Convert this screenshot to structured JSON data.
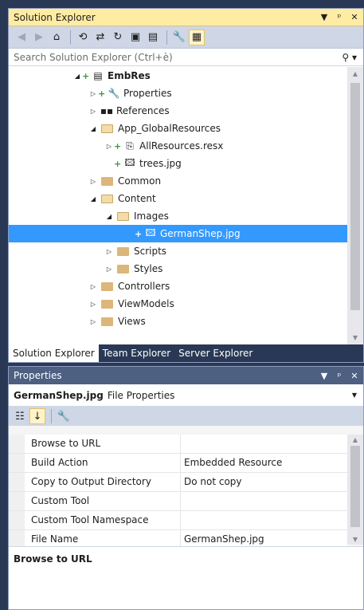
{
  "solution_explorer": {
    "title": "Solution Explorer",
    "search_placeholder": "Search Solution Explorer (Ctrl+è)",
    "tree": [
      {
        "label": "EmbRes",
        "bold": true,
        "indent": 0
      },
      {
        "label": "Properties",
        "indent": 1
      },
      {
        "label": "References",
        "indent": 1
      },
      {
        "label": "App_GlobalResources",
        "indent": 1
      },
      {
        "label": "AllResources.resx",
        "indent": 2
      },
      {
        "label": "trees.jpg",
        "indent": 2
      },
      {
        "label": "Common",
        "indent": 1
      },
      {
        "label": "Content",
        "indent": 1
      },
      {
        "label": "Images",
        "indent": 2
      },
      {
        "label": "GermanShep.jpg",
        "indent": 3,
        "selected": true
      },
      {
        "label": "Scripts",
        "indent": 2
      },
      {
        "label": "Styles",
        "indent": 2
      },
      {
        "label": "Controllers",
        "indent": 1
      },
      {
        "label": "ViewModels",
        "indent": 1
      },
      {
        "label": "Views",
        "indent": 1
      }
    ],
    "tabs": [
      "Solution Explorer",
      "Team Explorer",
      "Server Explorer"
    ],
    "active_tab": "Solution Explorer"
  },
  "properties": {
    "title": "Properties",
    "object_name": "GermanShep.jpg",
    "object_kind": "File Properties",
    "rows": [
      {
        "name": "Browse to URL",
        "value": ""
      },
      {
        "name": "Build Action",
        "value": "Embedded Resource"
      },
      {
        "name": "Copy to Output Directory",
        "value": "Do not copy"
      },
      {
        "name": "Custom Tool",
        "value": ""
      },
      {
        "name": "Custom Tool Namespace",
        "value": ""
      },
      {
        "name": "File Name",
        "value": "GermanShep.jpg"
      }
    ],
    "description_title": "Browse to URL"
  },
  "colors": {
    "chrome": "#293955",
    "active_title": "#ffeca3",
    "selection": "#3399ff",
    "folder": "#dcb67a"
  }
}
